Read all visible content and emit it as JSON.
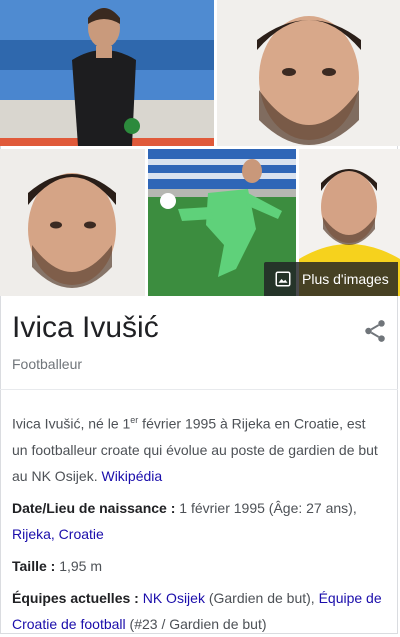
{
  "person": {
    "name": "Ivica Ivušić",
    "subtitle": "Footballeur"
  },
  "images": {
    "more_label": "Plus d'images",
    "icon": "image-icon"
  },
  "share": {
    "icon": "share-icon"
  },
  "description": {
    "part1": "Ivica Ivušić, né le 1",
    "sup": "er",
    "part2": " février 1995 à Rijeka en Croatie, est un footballeur croate qui évolue au poste de gardien de but au NK Osijek. ",
    "source_link": "Wikipédia"
  },
  "facts": {
    "birth": {
      "label": "Date/Lieu de naissance : ",
      "value": "1 février 1995 (Âge: 27 ans), ",
      "link": "Rijeka, Croatie"
    },
    "height": {
      "label": "Taille : ",
      "value": "1,95 m"
    },
    "teams": {
      "label": "Équipes actuelles : ",
      "link1": "NK Osijek",
      "text1": " (Gardien de but), ",
      "link2": "Équipe de Croatie de football",
      "text2": " (#23 / Gardien de but)"
    }
  },
  "colors": {
    "link": "#1a0dab",
    "keeper_green": "#5fd17a",
    "keeper_yellow": "#f6d21d",
    "stadium_blue": "#3a78c2"
  }
}
